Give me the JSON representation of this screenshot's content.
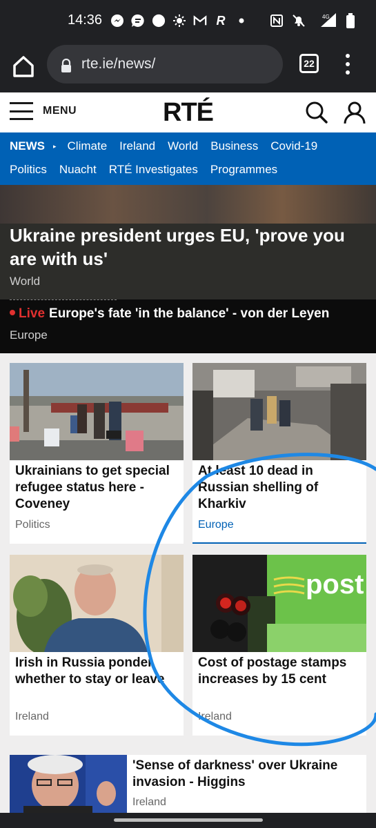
{
  "status_bar": {
    "time": "14:36",
    "left_icons": [
      "messenger-icon",
      "chat-icon",
      "circle-icon",
      "brightness-icon",
      "gmail-icon",
      "r-app-icon",
      "dot-icon"
    ],
    "right_icons": [
      "nfc-icon",
      "mute-icon",
      "signal-4g-icon",
      "battery-icon"
    ],
    "network": "4G"
  },
  "browser": {
    "url": "rte.ie/news/",
    "tab_count": "22"
  },
  "header": {
    "menu_label": "MENU",
    "logo": "RTÉ"
  },
  "nav": {
    "section": "NEWS",
    "row1": [
      "Climate",
      "Ireland",
      "World",
      "Business",
      "Covid-19"
    ],
    "row2": [
      "Politics",
      "Nuacht",
      "RTÉ Investigates",
      "Programmes"
    ]
  },
  "hero": {
    "title": "Ukraine president urges EU, 'prove you are with us'",
    "category": "World"
  },
  "live": {
    "label": "Live",
    "headline": "Europe's fate 'in the balance' - von der Leyen",
    "category": "Europe"
  },
  "cards": [
    {
      "title": "Ukrainians to get special refugee status here - Coveney",
      "category": "Politics"
    },
    {
      "title": "At least 10 dead in Russian shelling of Kharkiv",
      "category": "Europe"
    },
    {
      "title": "Irish in Russia ponder whether to stay or leave",
      "category": "Ireland"
    },
    {
      "title": "Cost of postage stamps increases by 15 cent",
      "category": "Ireland"
    }
  ],
  "wide_story": {
    "title": "'Sense of darkness' over Ukraine invasion - Higgins",
    "category": "Ireland"
  },
  "post_sign": "post",
  "colors": {
    "nav_blue": "#0061b5",
    "live_red": "#e0302f",
    "annotation_circle": "#1e88e5"
  }
}
